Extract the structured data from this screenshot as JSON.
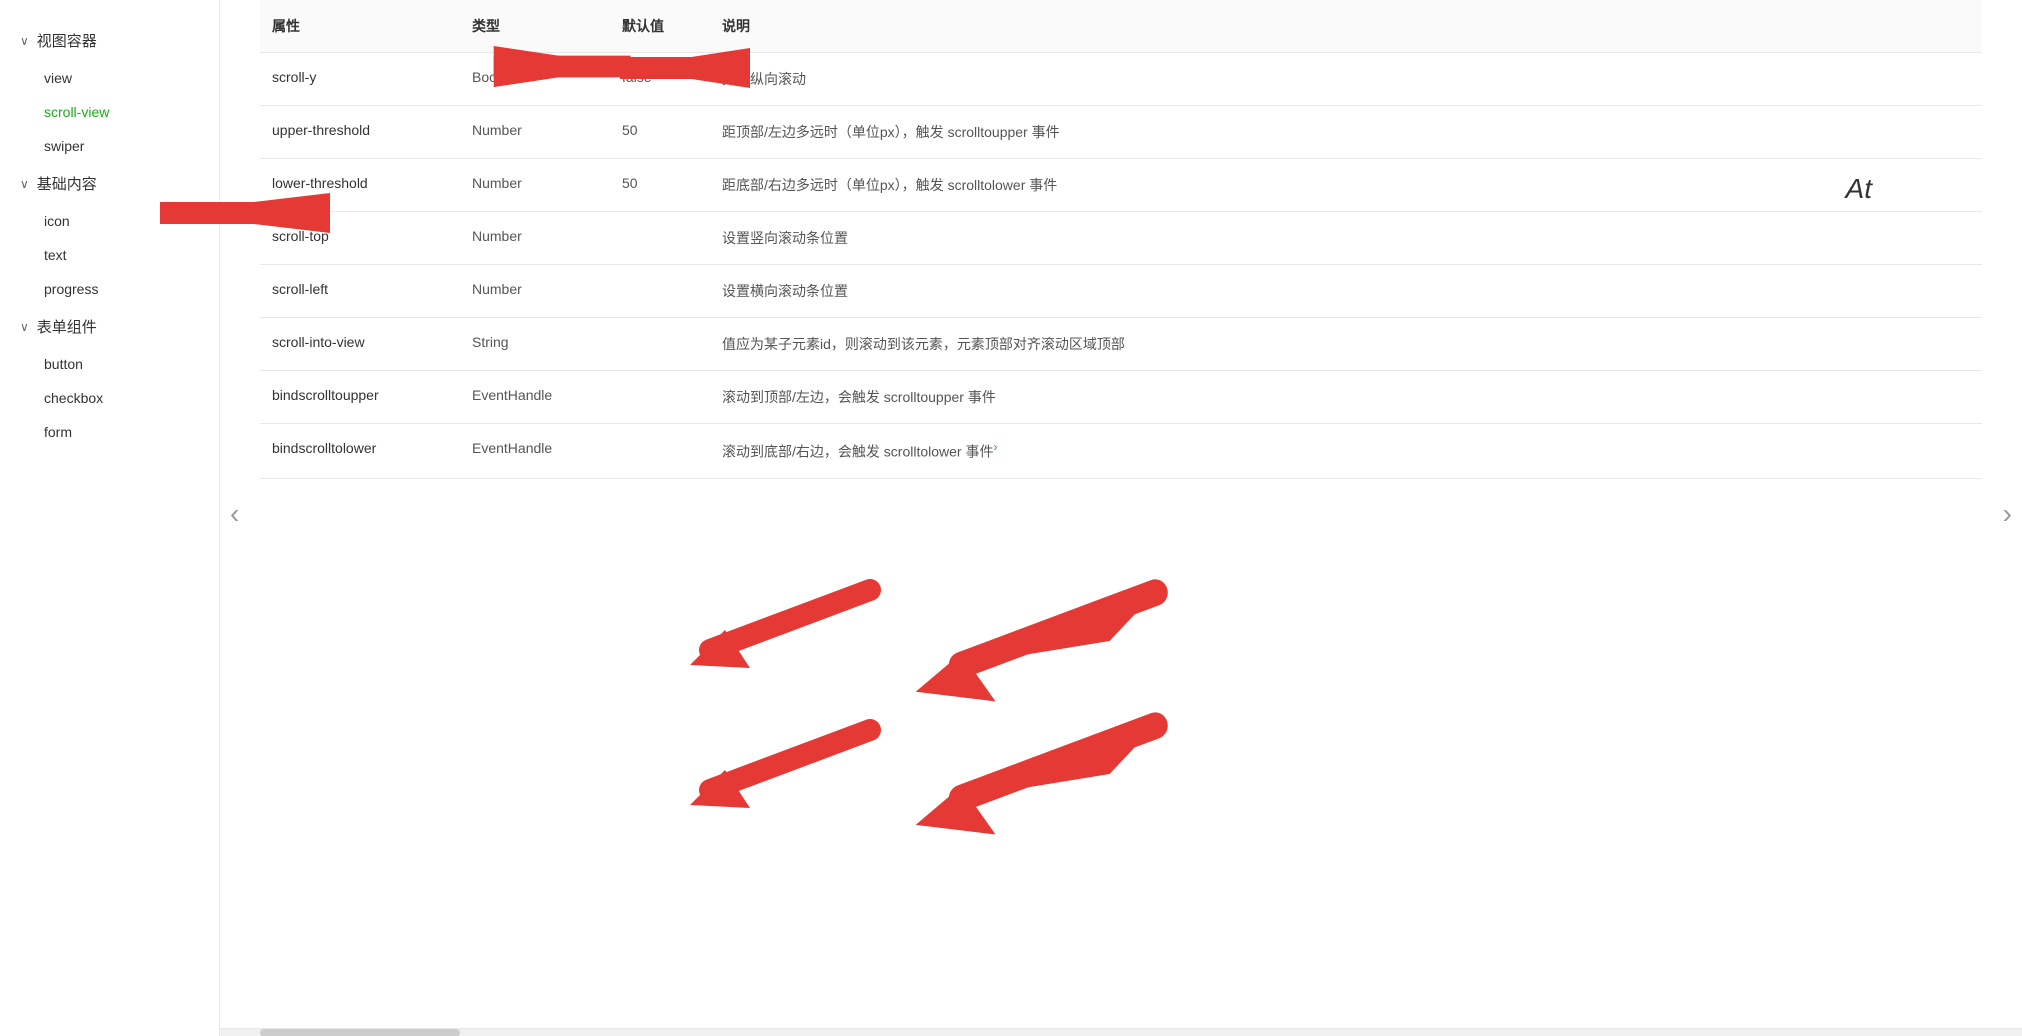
{
  "sidebar": {
    "categories": [
      {
        "label": "视图容器",
        "expanded": true,
        "items": [
          {
            "label": "view",
            "active": false
          },
          {
            "label": "scroll-view",
            "active": true
          },
          {
            "label": "swiper",
            "active": false
          }
        ]
      },
      {
        "label": "基础内容",
        "expanded": true,
        "items": [
          {
            "label": "icon",
            "active": false
          },
          {
            "label": "text",
            "active": false
          },
          {
            "label": "progress",
            "active": false
          }
        ]
      },
      {
        "label": "表单组件",
        "expanded": true,
        "items": [
          {
            "label": "button",
            "active": false
          },
          {
            "label": "checkbox",
            "active": false
          },
          {
            "label": "form",
            "active": false
          }
        ]
      }
    ]
  },
  "table": {
    "columns": [
      "属性",
      "类型",
      "默认值",
      "说明"
    ],
    "rows": [
      {
        "name": "scroll-y",
        "type": "Boolean",
        "default": "false",
        "desc": "允许纵向滚动",
        "has_arrow": true,
        "arrow_dir": "right"
      },
      {
        "name": "upper-threshold",
        "type": "Number",
        "default": "50",
        "desc": "距顶部/左边多远时（单位px），触发 scrolltoupper 事件",
        "has_arrow": false
      },
      {
        "name": "lower-threshold",
        "type": "Number",
        "default": "50",
        "desc": "距底部/右边多远时（单位px），触发 scrolltolower 事件",
        "has_arrow": false
      },
      {
        "name": "scroll-top",
        "type": "Number",
        "default": "",
        "desc": "设置竖向滚动条位置",
        "has_arrow": false
      },
      {
        "name": "scroll-left",
        "type": "Number",
        "default": "",
        "desc": "设置横向滚动条位置",
        "has_arrow": false
      },
      {
        "name": "scroll-into-view",
        "type": "String",
        "default": "",
        "desc": "值应为某子元素id，则滚动到该元素，元素顶部对齐滚动区域顶部",
        "has_arrow": false
      },
      {
        "name": "bindscrolltoupper",
        "type": "EventHandle",
        "default": "",
        "desc": "滚动到顶部/左边，会触发 scrolltoupper 事件",
        "has_arrow": true,
        "arrow_dir": "down"
      },
      {
        "name": "bindscrolltolower",
        "type": "EventHandle",
        "default": "",
        "desc": "滚动到底部/右边，会触发 scrolltolower 事件",
        "has_arrow": true,
        "arrow_dir": "down",
        "has_link": true
      }
    ]
  },
  "nav": {
    "left_arrow": "‹",
    "right_arrow": "›"
  },
  "at_label": "At"
}
